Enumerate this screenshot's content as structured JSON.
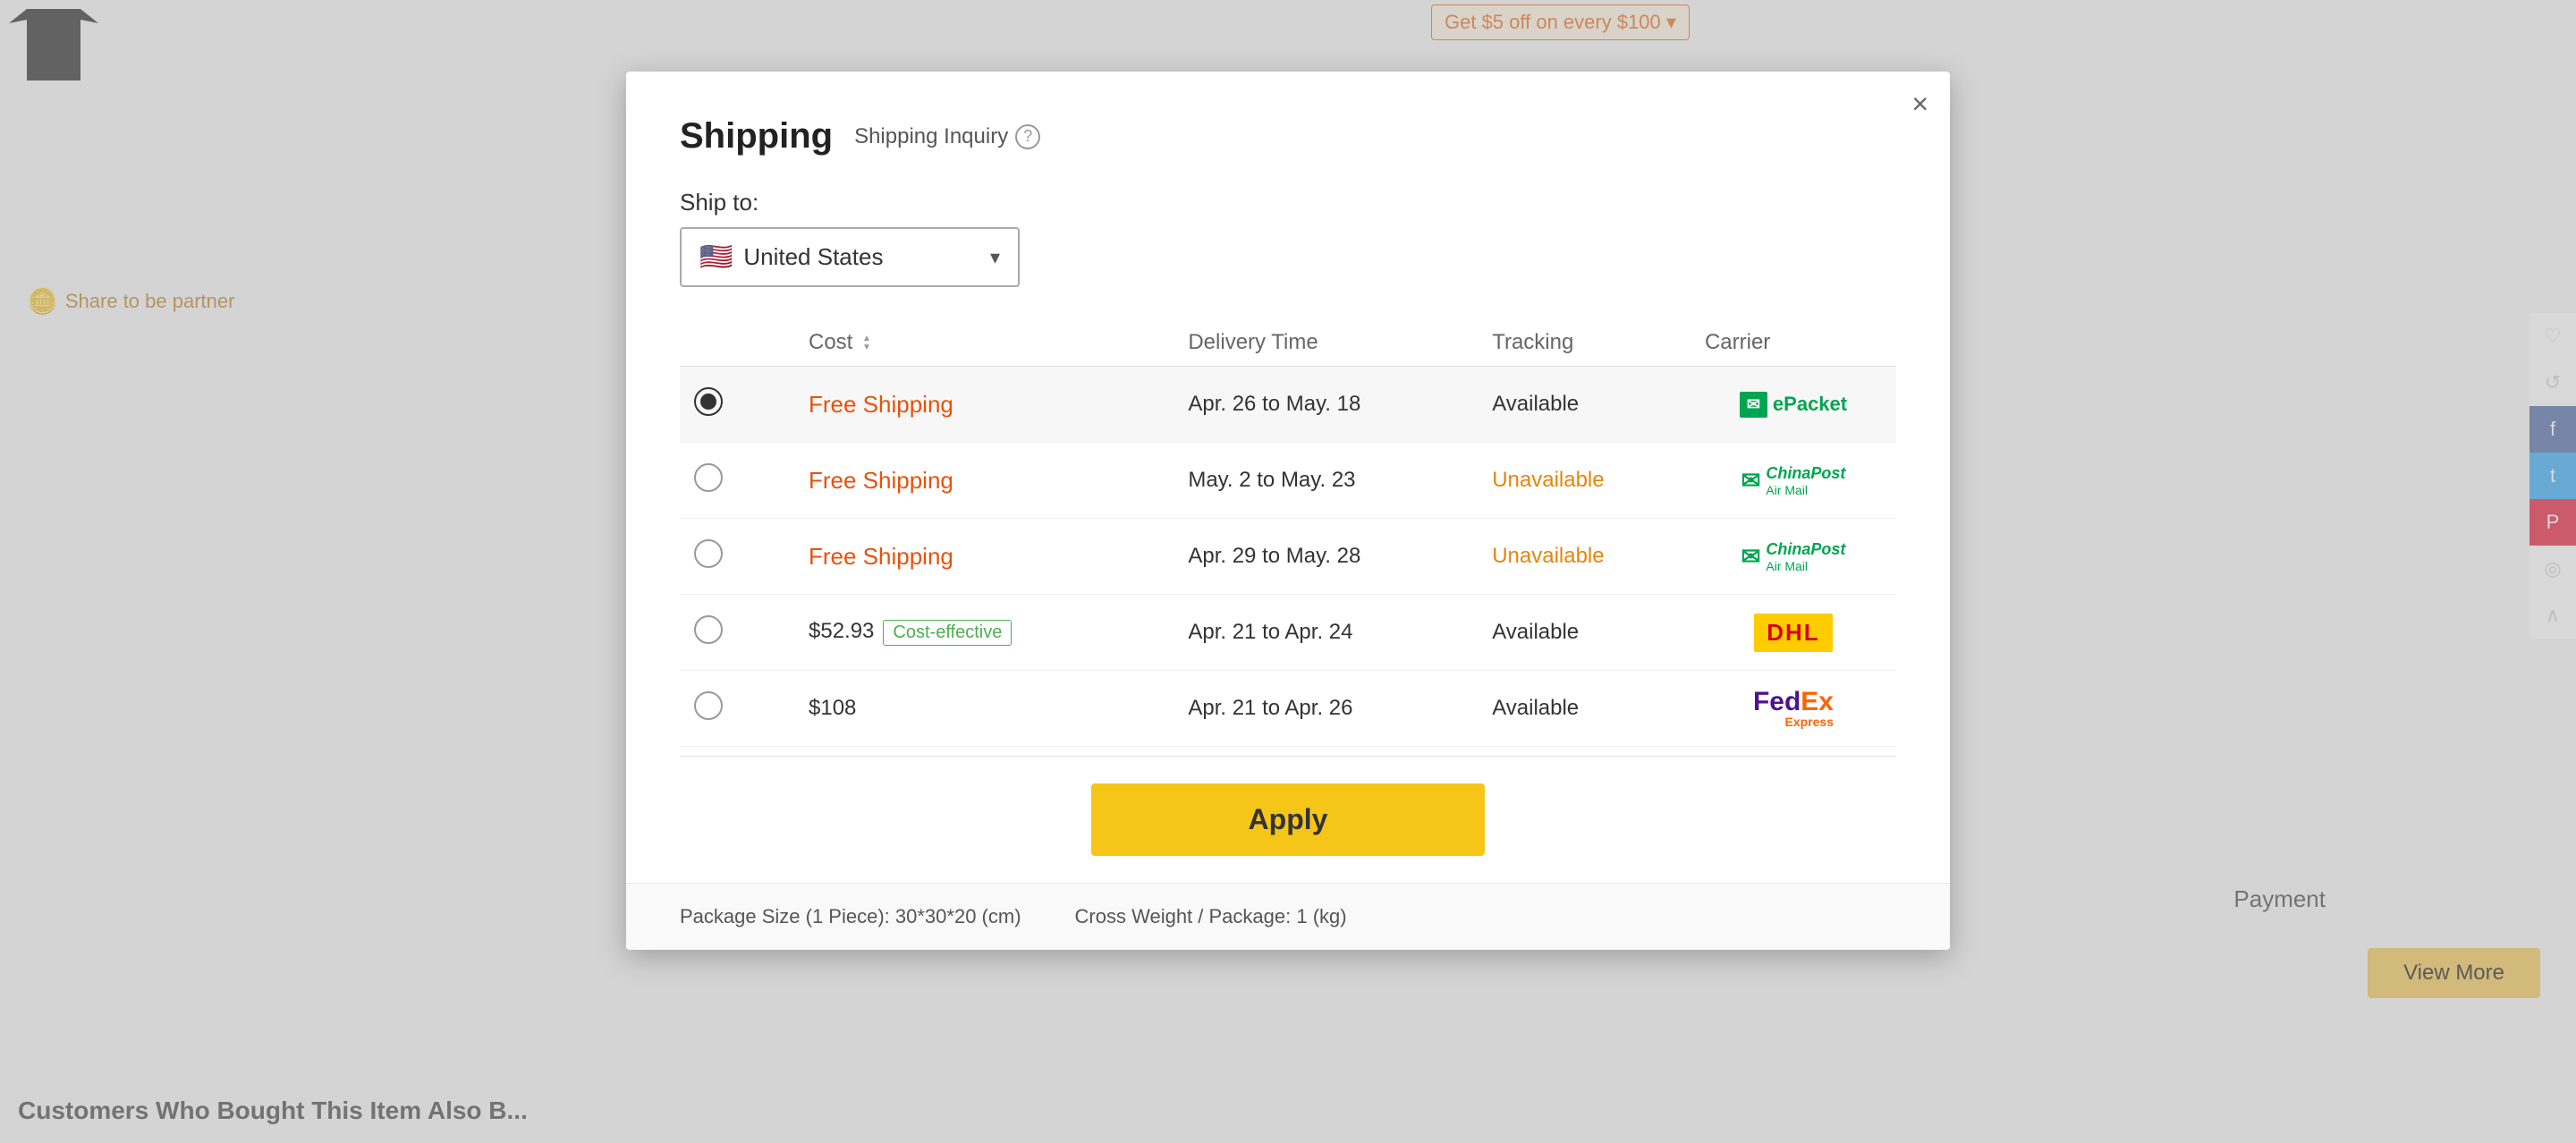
{
  "modal": {
    "title": "Shipping",
    "inquiry_label": "Shipping Inquiry",
    "close_label": "×",
    "ship_to_label": "Ship to:",
    "country": "United States",
    "country_flag": "🇺🇸",
    "table": {
      "columns": {
        "cost": "Cost",
        "delivery_time": "Delivery Time",
        "tracking": "Tracking",
        "carrier": "Carrier"
      },
      "rows": [
        {
          "selected": true,
          "cost": "Free Shipping",
          "cost_type": "free",
          "delivery": "Apr. 26 to May. 18",
          "tracking": "Available",
          "tracking_type": "available",
          "carrier": "ePacket"
        },
        {
          "selected": false,
          "cost": "Free Shipping",
          "cost_type": "free",
          "delivery": "May. 2 to May. 23",
          "tracking": "Unavailable",
          "tracking_type": "unavailable",
          "carrier": "ChinaPostAir"
        },
        {
          "selected": false,
          "cost": "Free Shipping",
          "cost_type": "free",
          "delivery": "Apr. 29 to May. 28",
          "tracking": "Unavailable",
          "tracking_type": "unavailable",
          "carrier": "ChinaPostAir"
        },
        {
          "selected": false,
          "cost": "$52.93",
          "cost_type": "paid",
          "cost_badge": "Cost-effective",
          "delivery": "Apr. 21 to Apr. 24",
          "tracking": "Available",
          "tracking_type": "available",
          "carrier": "DHL"
        },
        {
          "selected": false,
          "cost": "$108",
          "cost_type": "paid",
          "delivery": "Apr. 21 to Apr. 26",
          "tracking": "Available",
          "tracking_type": "available",
          "carrier": "FedEx"
        }
      ]
    },
    "apply_label": "Apply",
    "footer": {
      "package_size": "Package Size (1 Piece): 30*30*20 (cm)",
      "cross_weight": "Cross Weight / Package: 1 (kg)"
    }
  },
  "background": {
    "promo_text": "Get  $5  off on every  $100  ▾",
    "share_text": "Share to be partner",
    "payment_label": "Payment",
    "view_more_label": "View More",
    "customers_label": "Customers Who Bought This Item Also B..."
  },
  "social": {
    "heart": "♡",
    "history": "↺",
    "facebook": "f",
    "twitter": "t",
    "pinterest": "P",
    "hotspot": "◎",
    "scroll_up": "∧"
  }
}
